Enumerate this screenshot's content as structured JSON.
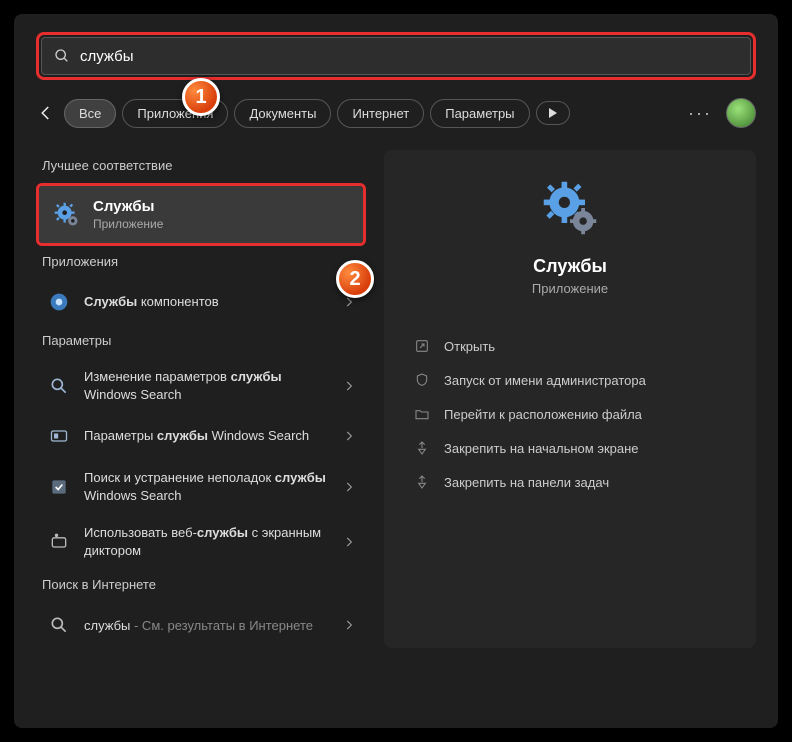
{
  "search": {
    "value": "службы"
  },
  "tabs": [
    {
      "label": "Все",
      "active": true
    },
    {
      "label": "Приложения",
      "active": false
    },
    {
      "label": "Документы",
      "active": false
    },
    {
      "label": "Интернет",
      "active": false
    },
    {
      "label": "Параметры",
      "active": false
    }
  ],
  "badges": {
    "one": "1",
    "two": "2"
  },
  "sections": {
    "best_match": "Лучшее соответствие",
    "apps": "Приложения",
    "settings": "Параметры",
    "web": "Поиск в Интернете"
  },
  "best_match": {
    "title": "Службы",
    "subtitle": "Приложение"
  },
  "apps_list": [
    {
      "pre": "",
      "hl": "Службы",
      "post": " компонентов"
    }
  ],
  "settings_list": [
    {
      "pre": "Изменение параметров ",
      "hl": "службы",
      "post": " Windows Search"
    },
    {
      "pre": "Параметры ",
      "hl": "службы",
      "post": " Windows Search"
    },
    {
      "pre": "Поиск и устранение неполадок ",
      "hl": "службы",
      "post": " Windows Search"
    },
    {
      "pre": "Использовать веб-",
      "hl": "службы",
      "post": " с экранным диктором"
    }
  ],
  "web_list": [
    {
      "term": "службы",
      "suffix": " - См. результаты в Интернете"
    }
  ],
  "detail": {
    "title": "Службы",
    "subtitle": "Приложение",
    "actions": [
      "Открыть",
      "Запуск от имени администратора",
      "Перейти к расположению файла",
      "Закрепить на начальном экране",
      "Закрепить на панели задач"
    ]
  }
}
